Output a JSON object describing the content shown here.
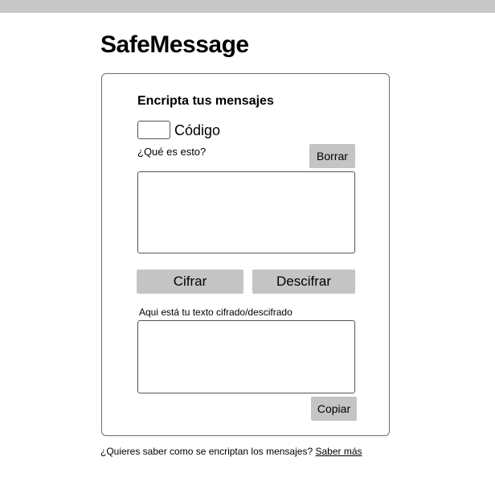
{
  "app": {
    "title": "SafeMessage"
  },
  "card": {
    "title": "Encripta tus mensajes",
    "code": {
      "label": "Código",
      "value": ""
    },
    "help_link": "¿Qué es esto?",
    "clear_label": "Borrar",
    "message": {
      "value": "",
      "placeholder": ""
    },
    "encrypt_label": "Cifrar",
    "decrypt_label": "Descifrar",
    "result": {
      "label": "Aqui está tu texto cifrado/descifrado",
      "value": ""
    },
    "copy_label": "Copiar"
  },
  "footer": {
    "question": "¿Quieres saber como se encriptan los mensajes?",
    "link": "Saber más"
  },
  "colors": {
    "top_bar": "#c8c8c8",
    "button": "#c4c4c4",
    "border": "#6e6e6e"
  }
}
